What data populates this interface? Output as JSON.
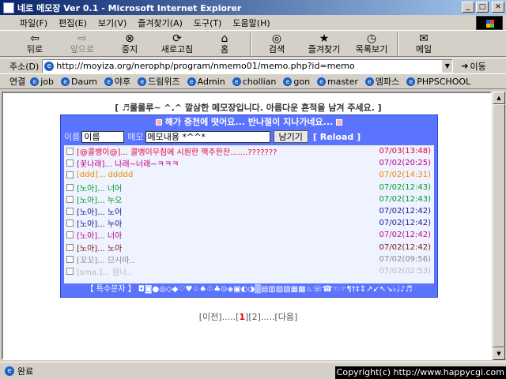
{
  "window": {
    "title": "네로 메모장 Ver 0.1 - Microsoft Internet Explorer"
  },
  "menu": [
    "파일(F)",
    "편집(E)",
    "보기(V)",
    "즐겨찾기(A)",
    "도구(T)",
    "도움말(H)"
  ],
  "toolbar": [
    {
      "label": "뒤로",
      "icon": "back-arrow-icon",
      "enabled": true
    },
    {
      "label": "앞으로",
      "icon": "forward-arrow-icon",
      "enabled": false
    },
    {
      "label": "중지",
      "icon": "stop-icon",
      "enabled": true
    },
    {
      "label": "새로고침",
      "icon": "refresh-icon",
      "enabled": true
    },
    {
      "label": "홈",
      "icon": "home-icon",
      "enabled": true
    },
    {
      "label": "검색",
      "icon": "search-icon",
      "enabled": true
    },
    {
      "label": "즐겨찾기",
      "icon": "favorites-icon",
      "enabled": true
    },
    {
      "label": "목록보기",
      "icon": "history-icon",
      "enabled": true
    },
    {
      "label": "메일",
      "icon": "mail-icon",
      "enabled": true
    }
  ],
  "address": {
    "label": "주소(D)",
    "url": "http://moyiza.org/nerophp/program/nmemo01/memo.php?id=memo",
    "go_label": "이동"
  },
  "links": {
    "label": "연결",
    "items": [
      "job",
      "Daum",
      "야후",
      "드림위즈",
      "Admin",
      "chollian",
      "gon",
      "master",
      "엠파스",
      "PHPSCHOOL"
    ]
  },
  "page": {
    "headline": "[ ♬룰룰루~ ^.^ 깔삼한 메모장입니다. 아름다운 흔적을 남겨 주세요. ]",
    "banner": "해가 중천에 떳어요... 반나절이 지나가네요...",
    "form": {
      "name_label": "이름",
      "name_value": "이름",
      "memo_label": "메모",
      "memo_value": "메모내용 *^^*",
      "submit": "남기기",
      "reload": "[ Reload ]"
    },
    "messages": [
      {
        "text": "[@콜뱅이@]... 콜뱅이무침에 시원한 맥주한잔.......???????",
        "date": "07/03(13:48)",
        "color": "#e8003a",
        "date_color": "#e8003a"
      },
      {
        "text": "[꽃나래]... 나래~너래~ㅋㅋㅋ",
        "date": "07/02(20:25)",
        "color": "#c7007a",
        "date_color": "#c7007a"
      },
      {
        "text": "[ddd]... ddddd",
        "date": "07/02(14:31)",
        "color": "#f28a00",
        "date_color": "#f28a00"
      },
      {
        "text": "[노아]... 너어",
        "date": "07/02(12:43)",
        "color": "#009a2a",
        "date_color": "#009a2a"
      },
      {
        "text": "[노아]... 누오",
        "date": "07/02(12:43)",
        "color": "#009a2a",
        "date_color": "#009a2a"
      },
      {
        "text": "[노아]... 노어",
        "date": "07/02(12:42)",
        "color": "#1a1a8a",
        "date_color": "#1a1a8a"
      },
      {
        "text": "[노아]... 누아",
        "date": "07/02(12:42)",
        "color": "#1a1a8a",
        "date_color": "#1a1a8a"
      },
      {
        "text": "[노아]... 너아",
        "date": "07/02(12:42)",
        "color": "#b0108a",
        "date_color": "#b0108a"
      },
      {
        "text": "[노아]... 노아",
        "date": "07/02(12:42)",
        "color": "#7a1a1a",
        "date_color": "#7a1a1a"
      },
      {
        "text": "[꼬꼬]... 므시따..",
        "date": "07/02(09:56)",
        "color": "#8a8a8a",
        "date_color": "#8a8a8a"
      },
      {
        "text": "[sma.]... 참나..",
        "date": "07/02(02:53)",
        "color": "#b8b8b8",
        "date_color": "#b8b8b8"
      }
    ],
    "special_chars": "【 특수문자 】 ◘◙●◎◇◆♡♥♤♠♧♣⊙◈▣◐◑▒▤▥▨▧▦▩♨☏☎☜☞¶†‡↕↗↙↖↘♭♩♪♬",
    "pager": {
      "prev": "[이전]",
      "dots": ".....",
      "pages": [
        "1",
        "2"
      ],
      "current": "1",
      "next": "[다음]"
    }
  },
  "status": {
    "text": "완료",
    "copyright": "Copyright(c) http://www.happycgi.com"
  }
}
